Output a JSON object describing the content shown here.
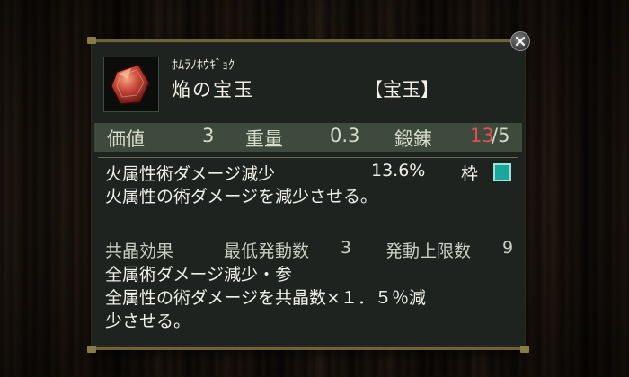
{
  "item": {
    "furigana": "ﾎﾑﾗﾉﾎｳｷﾞｮｸ",
    "name": "焔の宝玉",
    "category": "【宝玉】",
    "gem_color": "#c8483a"
  },
  "stats": {
    "value_label": "価値",
    "value": "3",
    "weight_label": "重量",
    "weight": "0.3",
    "forge_label": "鍛錬",
    "forge_current": "13",
    "forge_max": "/5",
    "forge_current_color": "#e0505a"
  },
  "effect": {
    "name": "火属性術ダメージ減少",
    "amount": "13.6%",
    "slot_label": "枠",
    "slot_color": "#1aa89a",
    "description": "火属性の術ダメージを減少させる。"
  },
  "resonance": {
    "label": "共晶効果",
    "min_label": "最低発動数",
    "min_value": "3",
    "max_label": "発動上限数",
    "max_value": "9",
    "name": "全属術ダメージ減少・参",
    "description_line1": "全属性の術ダメージを共晶数×１．５％減",
    "description_line2": "少させる。"
  },
  "icons": {
    "close": "close-icon",
    "gem": "gem-icon"
  }
}
